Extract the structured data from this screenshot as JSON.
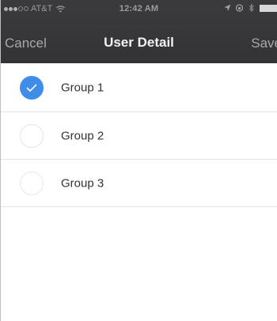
{
  "status_bar": {
    "carrier": "AT&T",
    "time": "12:42 AM"
  },
  "nav": {
    "cancel_label": "Cancel",
    "title": "User Detail",
    "save_label": "Save"
  },
  "groups": [
    {
      "label": "Group 1",
      "checked": true
    },
    {
      "label": "Group 2",
      "checked": false
    },
    {
      "label": "Group 3",
      "checked": false
    }
  ],
  "colors": {
    "accent": "#3f8de8",
    "nav_background": "#363638"
  }
}
